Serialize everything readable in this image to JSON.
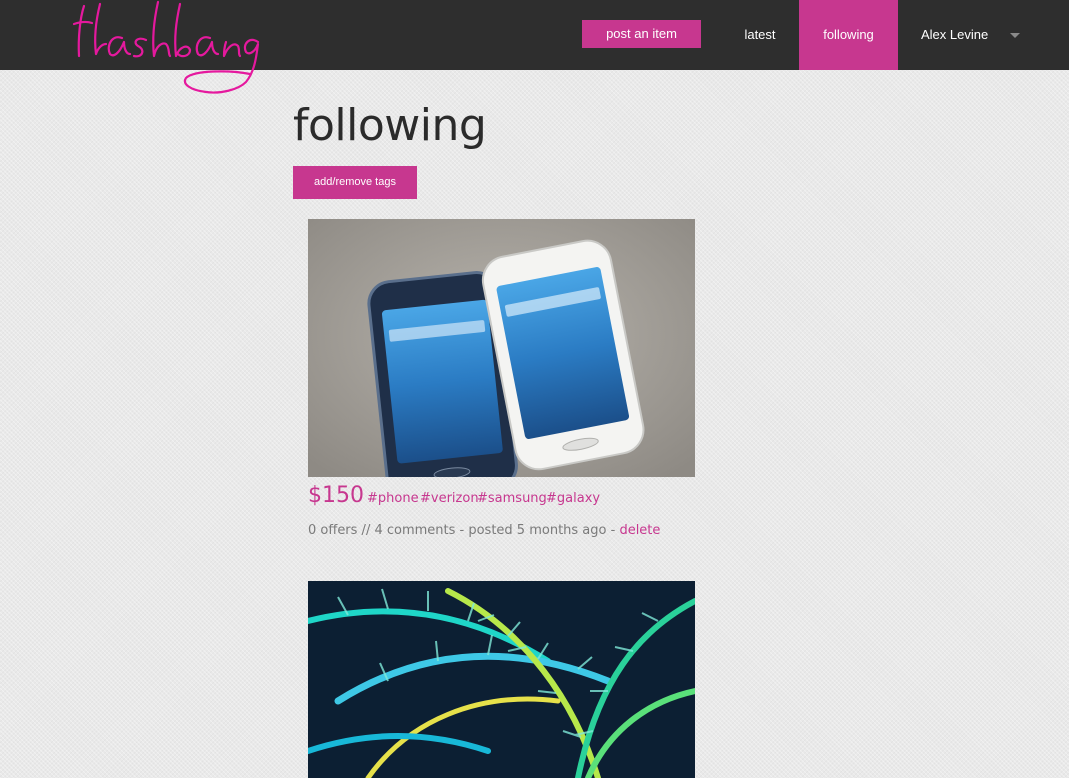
{
  "header": {
    "logo_text": "flashbang",
    "post_button": "post an item",
    "nav": {
      "latest": "latest",
      "following": "following",
      "user": "Alex Levine"
    },
    "icons": {
      "user_menu": "caret-down-icon"
    },
    "colors": {
      "bar": "#2e2e2e",
      "accent": "#c7378f"
    }
  },
  "main": {
    "title": "following",
    "tags_button": "add/remove tags",
    "items": [
      {
        "price": "$150",
        "tags": [
          "#phone",
          "#verizon",
          "#samsung",
          "#galaxy"
        ],
        "meta": "0 offers // 4 comments - posted 5 months ago - ",
        "delete_label": "delete",
        "image": "two smartphones on concrete"
      },
      {
        "image": "green palm fronds"
      }
    ]
  }
}
